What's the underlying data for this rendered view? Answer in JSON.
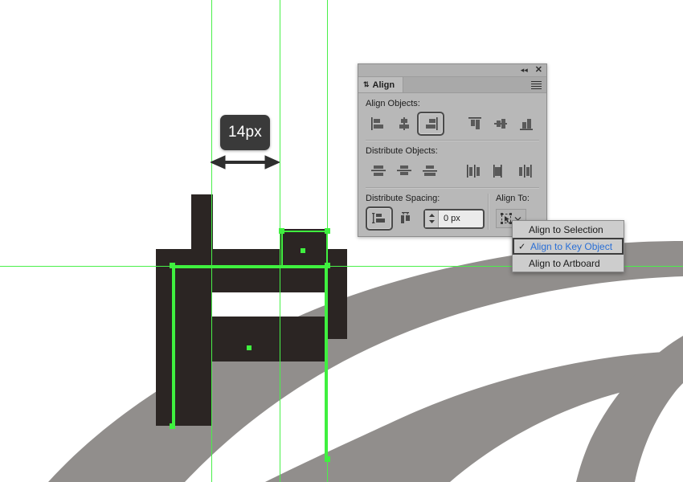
{
  "canvas": {
    "measurement": {
      "label": "14px",
      "arrow_icon": "double-headed-horizontal-arrow-icon"
    },
    "artwork_color": "#2b2523",
    "background_shape_color": "#918e8c",
    "guide_color": "#49f049",
    "selection_color": "#3ff03f"
  },
  "panel": {
    "title": "Align",
    "titlebar": {
      "collapse_icon": "◂◂",
      "close_icon": "✕",
      "menu_icon": "hamburger-menu-icon",
      "tab_grip_icon": "⇅"
    },
    "sections": {
      "align_objects": {
        "label": "Align Objects:",
        "buttons": [
          {
            "name": "horizontal-align-left",
            "selected": false
          },
          {
            "name": "horizontal-align-center",
            "selected": false
          },
          {
            "name": "horizontal-align-right",
            "selected": true
          },
          {
            "name": "vertical-align-top",
            "selected": false
          },
          {
            "name": "vertical-align-center",
            "selected": false
          },
          {
            "name": "vertical-align-bottom",
            "selected": false
          }
        ]
      },
      "distribute_objects": {
        "label": "Distribute Objects:",
        "buttons": [
          {
            "name": "vertical-distribute-top",
            "selected": false
          },
          {
            "name": "vertical-distribute-center",
            "selected": false
          },
          {
            "name": "vertical-distribute-bottom",
            "selected": false
          },
          {
            "name": "horizontal-distribute-left",
            "selected": false
          },
          {
            "name": "horizontal-distribute-center",
            "selected": false
          },
          {
            "name": "horizontal-distribute-right",
            "selected": false
          }
        ]
      },
      "distribute_spacing": {
        "label": "Distribute Spacing:",
        "buttons": [
          {
            "name": "vertical-distribute-space",
            "selected": true
          },
          {
            "name": "horizontal-distribute-space",
            "selected": false
          }
        ],
        "spacing_value": "0 px",
        "spinner_icon": "up-down-stepper-icon"
      },
      "align_to": {
        "label": "Align To:",
        "button_icon": "align-to-key-object-icon",
        "dropdown_icon": "chevron-down-icon"
      }
    }
  },
  "menu": {
    "items": [
      {
        "label": "Align to Selection",
        "checked": false
      },
      {
        "label": "Align to Key Object",
        "checked": true
      },
      {
        "label": "Align to Artboard",
        "checked": false
      }
    ],
    "check_glyph": "✓",
    "highlight_color": "#2a6fd6"
  }
}
